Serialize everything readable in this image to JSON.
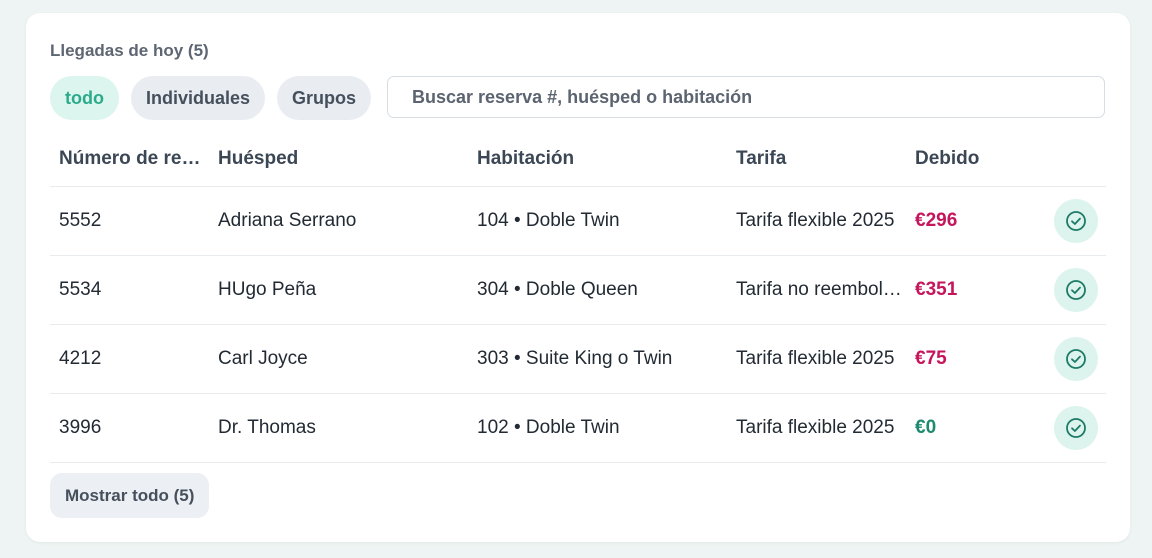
{
  "card": {
    "title": "Llegadas de hoy (5)"
  },
  "filters": [
    {
      "label": "todo",
      "active": true
    },
    {
      "label": "Individuales",
      "active": false
    },
    {
      "label": "Grupos",
      "active": false
    }
  ],
  "search": {
    "placeholder": "Buscar reserva #, huésped o habitación",
    "value": ""
  },
  "table": {
    "columns": [
      "Número de reserva",
      "Huésped",
      "Habitación",
      "Tarifa",
      "Debido"
    ],
    "rows": [
      {
        "reservation": "5552",
        "guest": "Adriana Serrano",
        "room": "104 • Doble Twin",
        "rate": "Tarifa flexible 2025",
        "due": "€296",
        "due_status": "owed"
      },
      {
        "reservation": "5534",
        "guest": "HUgo Peña",
        "room": "304 • Doble Queen",
        "rate": "Tarifa no reembolsable",
        "due": "€351",
        "due_status": "owed"
      },
      {
        "reservation": "4212",
        "guest": "Carl Joyce",
        "room": "303 • Suite King o Twin",
        "rate": "Tarifa flexible 2025",
        "due": "€75",
        "due_status": "owed"
      },
      {
        "reservation": "3996",
        "guest": "Dr. Thomas",
        "room": "102 • Doble Twin",
        "rate": "Tarifa flexible 2025",
        "due": "€0",
        "due_status": "paid"
      }
    ],
    "row_action_icon": "check-circle-icon"
  },
  "footer": {
    "show_all_label": "Mostrar todo (5)"
  },
  "colors": {
    "accent": "#2bab8c",
    "owed": "#c5165c",
    "paid": "#1d8a70",
    "check_bg": "#ddf4ee"
  }
}
